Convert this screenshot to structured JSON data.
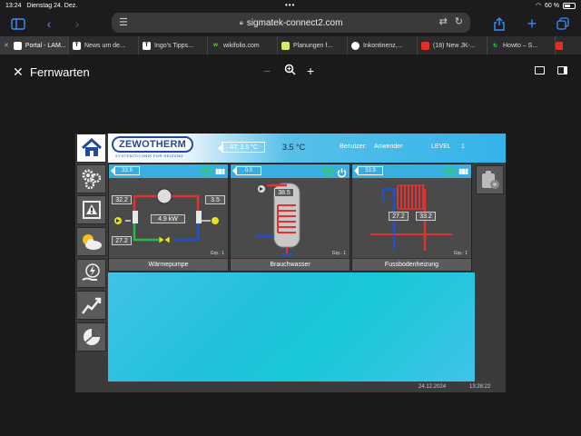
{
  "statusbar": {
    "time": "13:24",
    "date": "Dienstag 24. Dez.",
    "battery": "60 %"
  },
  "browser": {
    "url": "sigmatek-connect2.com"
  },
  "tabs": [
    {
      "label": "Portal - LAM...",
      "fav_color": "#ffffff",
      "fav_text": "",
      "active": true
    },
    {
      "label": "News um de...",
      "fav_color": "#ffffff",
      "fav_text": "T"
    },
    {
      "label": "Ingo's Tipps...",
      "fav_color": "#ffffff",
      "fav_text": "T"
    },
    {
      "label": "wikifolio.com",
      "fav_color": "#2c2c2e",
      "fav_text": "w"
    },
    {
      "label": "Planungen f...",
      "fav_color": "#d8e86a",
      "fav_text": ""
    },
    {
      "label": "Inkontinenz,...",
      "fav_color": "#ffffff",
      "fav_text": ""
    },
    {
      "label": "(18) New JK-...",
      "fav_color": "#e52d27",
      "fav_text": ""
    },
    {
      "label": "Howto – S...",
      "fav_color": "#2c2c2e",
      "fav_text": ""
    }
  ],
  "page": {
    "title": "Fernwarten"
  },
  "hmi": {
    "logo": "ZEWOTHERM",
    "logo_sub": "SYSTEMTECHNIK FÜR HEIZUNG",
    "at_label": "AT:   3.5 °C",
    "outside_temp": "3.5 °C",
    "user_label": "Benutzer:",
    "user_value": "Anwender",
    "level_label": "LEVEL",
    "level_value": "1",
    "date": "24.12.2024",
    "time": "13:28:22",
    "panels": [
      {
        "setpoint": "33.9",
        "title": "Wärmepumpe",
        "group": "Grp.: 1",
        "v1": "32.2",
        "v2": "3.5",
        "v3": "4.9 kW",
        "v4": "27.2"
      },
      {
        "setpoint": "0.0",
        "title": "Brauchwasser",
        "group": "Grp.: 1",
        "v1": "38.5"
      },
      {
        "setpoint": "33.9",
        "title": "Fussbodenheizung",
        "group": "Grp.: 1",
        "v1": "27.2",
        "v2": "33.2"
      }
    ]
  },
  "colors": {
    "accent_blue": "#39aee0",
    "active_green": "#27d84b",
    "safari_blue": "#3d8eff"
  },
  "icons": [
    "home-icon",
    "settings-icon",
    "alarm-icon",
    "weather-icon",
    "energy-icon",
    "trend-icon",
    "chart-icon",
    "export-icon"
  ]
}
